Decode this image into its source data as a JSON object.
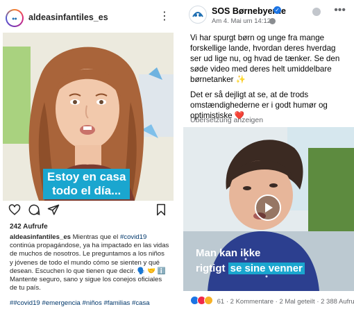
{
  "instagram": {
    "username": "aldeasinfantiles_es",
    "more_icon": "more-vertical-icon",
    "video_caption_line1": "Estoy en casa",
    "video_caption_line2": "todo el día...",
    "actions": [
      "heart-icon",
      "comment-icon",
      "share-icon",
      "bookmark-icon"
    ],
    "views": "242 Aufrufe",
    "caption_user": "aldeasinfantiles_es",
    "caption_part1": " Mientras que el ",
    "caption_tag1": "#covid19",
    "caption_part2": " continúa propagándose, ya ha impactado en las vidas de muchos de nosotros. Le preguntamos a los niños y jóvenes de todo el mundo cómo se sienten y qué desean. Escuchen lo que tienen que decir. 🗣️ 🤝 ℹ️",
    "caption_part3": "Mantente seguro, sano y sigue los conejos oficiales de tu país.",
    "hashtags": "##covid19 #emergencia #niños #familias #casa",
    "brand_color": "#1aa6cf"
  },
  "facebook": {
    "page_name": "SOS Børnebyerne",
    "verified_icon": "verified-check-icon",
    "date": "Am 4. Mai um 14:12 ·",
    "more_icon": "more-horizontal-icon",
    "paragraph1": "Vi har spurgt børn og unge fra mange forskellige lande, hvordan deres hverdag ser ud lige nu, og hvad de tænker. Se den søde video med deres helt umiddelbare børnetanker ✨",
    "paragraph2": "Det er så dejligt at se, at de trods omstændighederne er i godt humør og optimistiske ❤️",
    "translate_link": "Übersetzung anzeigen",
    "subtitle_line1": "Man kan ikke",
    "subtitle_line2_plain": "rigtigt ",
    "subtitle_line2_highlight": "se sine venner",
    "play_icon": "play-icon",
    "reactions_count": "61",
    "comments": "2 Kommentare",
    "shares": "2 Mal geteilt",
    "views": "2 388 Aufrufe",
    "separator": " · ",
    "brand_color": "#1b74e4"
  }
}
